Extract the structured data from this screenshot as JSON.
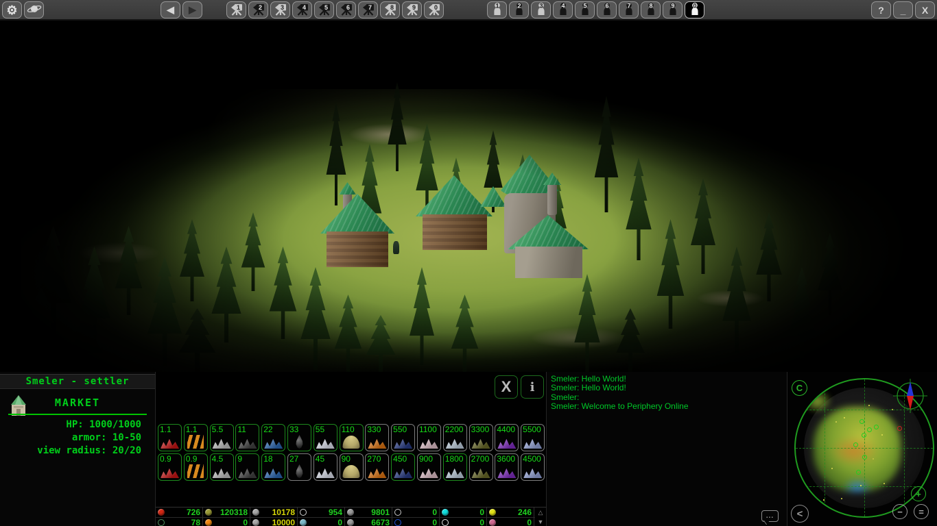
{
  "window": {
    "help": "?",
    "minimize": "_",
    "close": "X"
  },
  "toolbar": {
    "camera_buttons": [
      {
        "num": "1",
        "tone": "tone-light"
      },
      {
        "num": "2",
        "tone": "tone-dark"
      },
      {
        "num": "3",
        "tone": "tone-light"
      },
      {
        "num": "4",
        "tone": "tone-dark"
      },
      {
        "num": "5",
        "tone": "tone-dark"
      },
      {
        "num": "6",
        "tone": "tone-dark"
      },
      {
        "num": "7",
        "tone": "tone-dark"
      },
      {
        "num": "8",
        "tone": "tone-light"
      },
      {
        "num": "9",
        "tone": "tone-light"
      },
      {
        "num": "0",
        "tone": "tone-light"
      }
    ],
    "unit_buttons": [
      {
        "num": "1",
        "tone": "tone-light"
      },
      {
        "num": "2",
        "tone": "tone-dark"
      },
      {
        "num": "3",
        "tone": "tone-light"
      },
      {
        "num": "4",
        "tone": "tone-dark"
      },
      {
        "num": "5",
        "tone": "tone-dark"
      },
      {
        "num": "6",
        "tone": "tone-dark"
      },
      {
        "num": "7",
        "tone": "tone-dark"
      },
      {
        "num": "8",
        "tone": "tone-dark"
      },
      {
        "num": "9",
        "tone": "tone-dark"
      },
      {
        "num": "0",
        "tone": "tone-selected"
      }
    ]
  },
  "selection": {
    "title": "Smeler - settler",
    "building_name": "MARKET",
    "stats": [
      {
        "label": "HP:",
        "value": " 1000/1000"
      },
      {
        "label": "armor:",
        "value": " 10-50"
      },
      {
        "label": "view radius:",
        "value": " 20/20"
      }
    ]
  },
  "market": {
    "close_label": "X",
    "info_label": "i",
    "sell_row": [
      {
        "price": "1.1",
        "icon": "pile",
        "c": "#d61616",
        "border": "green"
      },
      {
        "price": "1.1",
        "icon": "logs",
        "c": "#d8891f",
        "border": "green"
      },
      {
        "price": "5.5",
        "icon": "pile",
        "c": "#cfcfcf",
        "border": "green"
      },
      {
        "price": "11",
        "icon": "pile",
        "c": "#464646",
        "border": "green"
      },
      {
        "price": "22",
        "icon": "pile",
        "c": "#2e6fc0",
        "border": "green"
      },
      {
        "price": "33",
        "icon": "drop",
        "c": "#3c3c3c",
        "border": "green"
      },
      {
        "price": "55",
        "icon": "pile",
        "c": "#eef2ff",
        "border": "green"
      },
      {
        "price": "110",
        "icon": "mound",
        "c": "#b3a768",
        "border": "green"
      },
      {
        "price": "330",
        "icon": "pile",
        "c": "#ef7d12",
        "border": "gray"
      },
      {
        "price": "550",
        "icon": "pile",
        "c": "#2a3f8f",
        "border": "gray"
      },
      {
        "price": "1100",
        "icon": "pile",
        "c": "#f2cfd8",
        "border": "gray"
      },
      {
        "price": "2200",
        "icon": "pile",
        "c": "#cfe0f0",
        "border": "gray"
      },
      {
        "price": "3300",
        "icon": "pile",
        "c": "#70702a",
        "border": "gray"
      },
      {
        "price": "4400",
        "icon": "pile",
        "c": "#8a2fd0",
        "border": "gray"
      },
      {
        "price": "5500",
        "icon": "pile",
        "c": "#9fb0ea",
        "border": "gray"
      }
    ],
    "buy_row": [
      {
        "price": "0.9",
        "icon": "pile",
        "c": "#d61616",
        "border": "green"
      },
      {
        "price": "0.9",
        "icon": "logs",
        "c": "#d8891f",
        "border": "green"
      },
      {
        "price": "4.5",
        "icon": "pile",
        "c": "#cfcfcf",
        "border": "green"
      },
      {
        "price": "9",
        "icon": "pile",
        "c": "#464646",
        "border": "green"
      },
      {
        "price": "18",
        "icon": "pile",
        "c": "#2e6fc0",
        "border": "green"
      },
      {
        "price": "27",
        "icon": "drop",
        "c": "#3c3c3c",
        "border": "gray"
      },
      {
        "price": "45",
        "icon": "pile",
        "c": "#eef2ff",
        "border": "gray"
      },
      {
        "price": "90",
        "icon": "mound",
        "c": "#b3a768",
        "border": "gray"
      },
      {
        "price": "270",
        "icon": "pile",
        "c": "#ef7d12",
        "border": "gray"
      },
      {
        "price": "450",
        "icon": "pile",
        "c": "#2a3f8f",
        "border": "green"
      },
      {
        "price": "900",
        "icon": "pile",
        "c": "#f2cfd8",
        "border": "gray"
      },
      {
        "price": "1800",
        "icon": "pile",
        "c": "#cfe0f0",
        "border": "green"
      },
      {
        "price": "2700",
        "icon": "pile",
        "c": "#70702a",
        "border": "gray"
      },
      {
        "price": "3600",
        "icon": "pile",
        "c": "#8a2fd0",
        "border": "gray"
      },
      {
        "price": "4500",
        "icon": "pile",
        "c": "#9fb0ea",
        "border": "gray"
      }
    ]
  },
  "chat": {
    "messages": [
      {
        "text": "Smeler: Hello World!"
      },
      {
        "text": "Smeler: Hello World!"
      },
      {
        "text": "Smeler:"
      },
      {
        "text": "Smeler: Welcome to Periphery Online"
      }
    ]
  },
  "resources": {
    "row1": [
      {
        "icon": "filled",
        "c": "#d22814",
        "value": "726",
        "vc": "#20d020"
      },
      {
        "icon": "filled",
        "c": "#9a9a35",
        "value": "120318",
        "vc": "#20d020"
      },
      {
        "icon": "filled",
        "c": "#a8a8a8",
        "value": "10178",
        "vc": "#d8d808"
      },
      {
        "icon": "outline",
        "c": "#cfcfcf",
        "value": "954",
        "vc": "#20d020"
      },
      {
        "icon": "filled",
        "c": "#9a9a9a",
        "value": "9801",
        "vc": "#20d020"
      },
      {
        "icon": "outline",
        "c": "#c8c8c8",
        "value": "0",
        "vc": "#20d020"
      },
      {
        "icon": "filled",
        "c": "#12dede",
        "value": "0",
        "vc": "#20d020"
      },
      {
        "icon": "filled",
        "c": "#e2e218",
        "value": "246",
        "vc": "#20d020"
      }
    ],
    "row2": [
      {
        "icon": "outline",
        "c": "#4f8f5f",
        "value": "78",
        "vc": "#20d020"
      },
      {
        "icon": "filled",
        "c": "#ef8812",
        "value": "0",
        "vc": "#20d020"
      },
      {
        "icon": "filled",
        "c": "#a8a8a8",
        "value": "10000",
        "vc": "#d8d808"
      },
      {
        "icon": "filled",
        "c": "#7ab8c8",
        "value": "0",
        "vc": "#20d020"
      },
      {
        "icon": "filled",
        "c": "#9a9a9a",
        "value": "6673",
        "vc": "#20d020"
      },
      {
        "icon": "outline",
        "c": "#2255e0",
        "value": "0",
        "vc": "#20d020"
      },
      {
        "icon": "outline",
        "c": "#e8e8e8",
        "value": "0",
        "vc": "#20d020"
      },
      {
        "icon": "filled",
        "c": "#d06890",
        "value": "0",
        "vc": "#20d020"
      }
    ],
    "scroll_up": "△",
    "scroll_down": "▼"
  },
  "minimap": {
    "center_button": "C",
    "back_button": "<",
    "zoom_in": "+",
    "zoom_out": "−",
    "equal_button": "="
  },
  "colors": {
    "ui_green": "#00cf1a",
    "value_yellow": "#d8d808",
    "market_border_green": "#1d8a1d",
    "market_border_gray": "#7d7d7d",
    "chat_green": "#00c828"
  }
}
